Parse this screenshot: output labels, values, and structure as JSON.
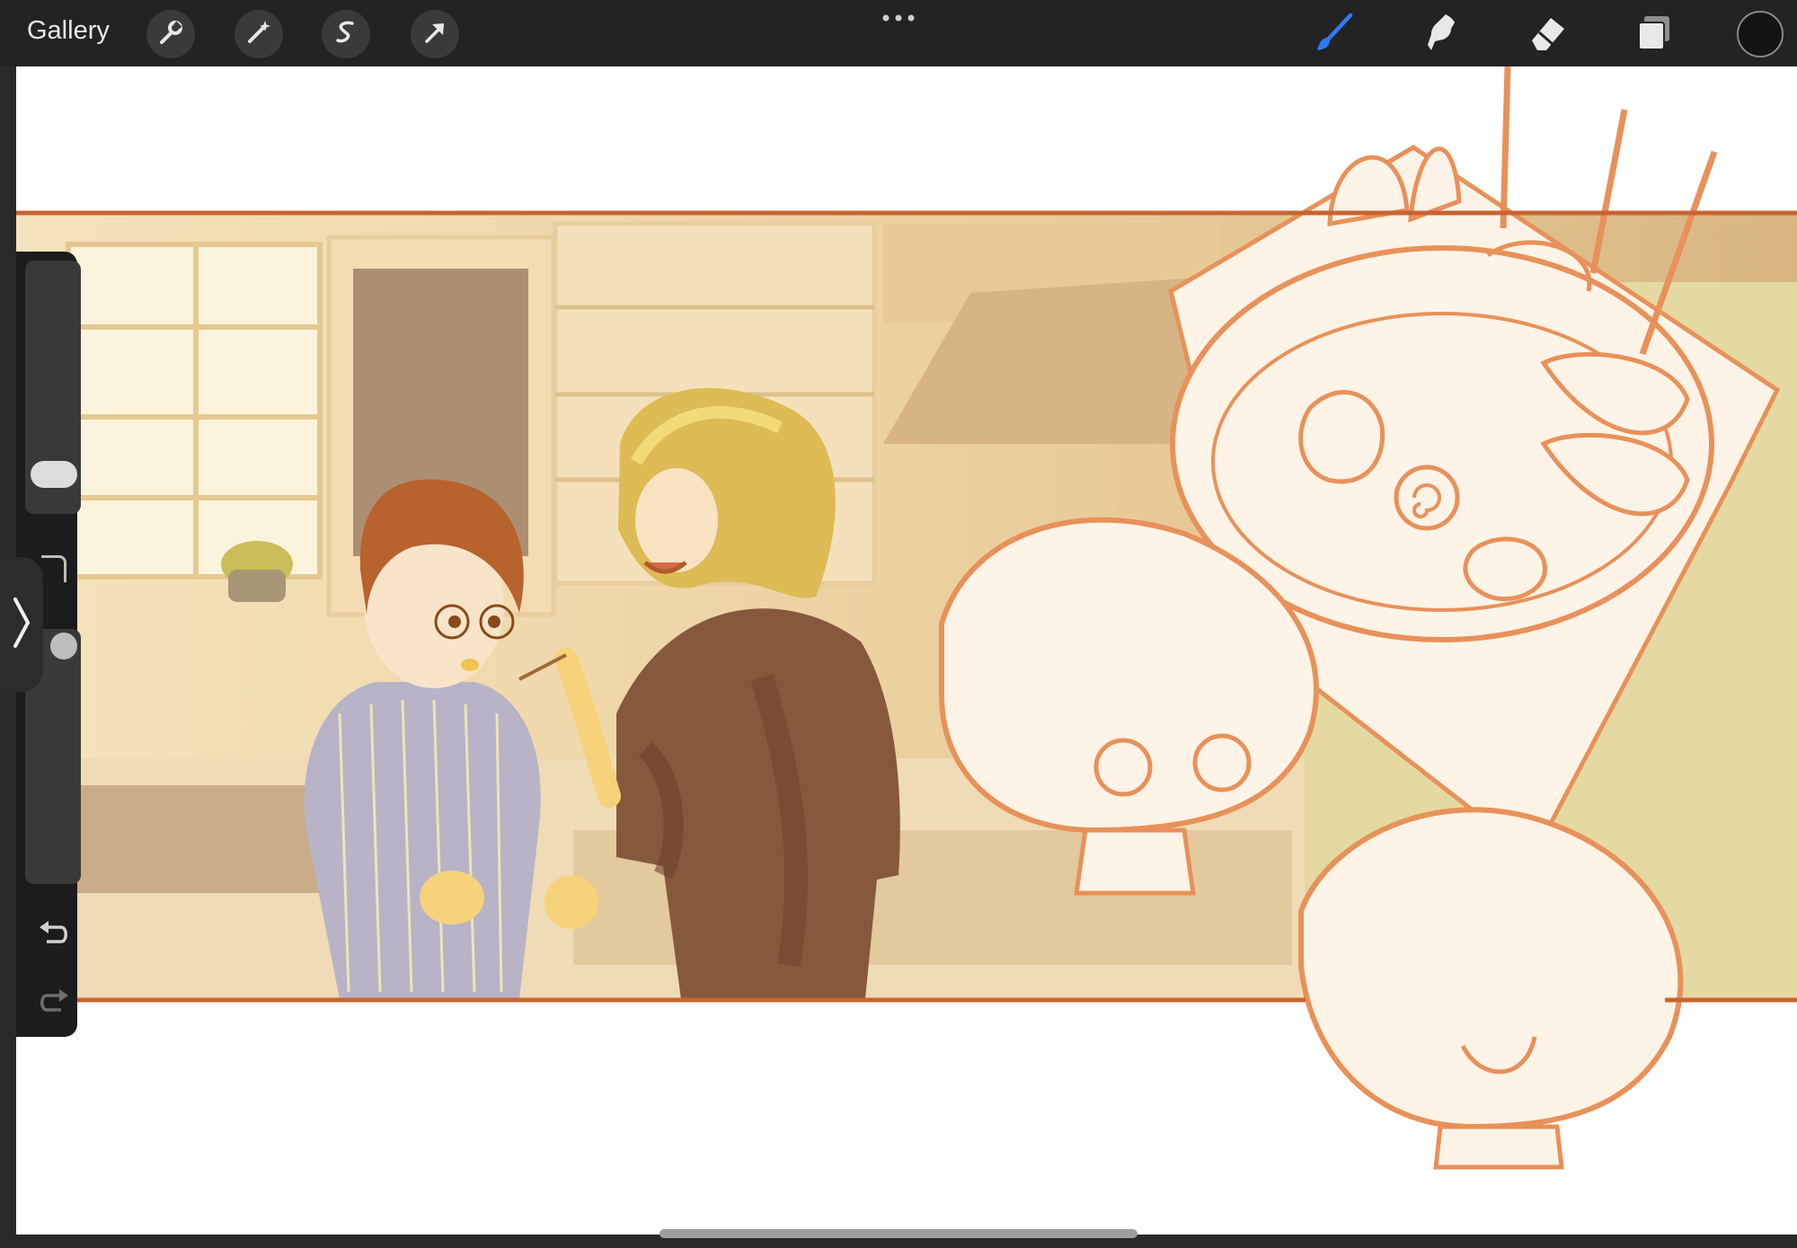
{
  "topbar": {
    "gallery_label": "Gallery",
    "left_tools": [
      "wrench-icon",
      "magic-wand-icon",
      "selection-icon",
      "transform-arrow-icon"
    ],
    "more_menu": "more-dots-icon",
    "right_tools": [
      "brush-icon",
      "smudge-icon",
      "eraser-icon",
      "layers-icon"
    ],
    "active_tool": "brush-icon",
    "current_color": "#141416",
    "accent_color": "#2f7cf6"
  },
  "sidebar": {
    "controls": [
      "brush-size-slider",
      "modify-button",
      "brush-opacity-slider",
      "undo-button",
      "redo-button"
    ],
    "collapse_icon": "chevron-right-icon"
  },
  "canvas": {
    "artwork": "kitchen-illustration",
    "colors": {
      "border": "#c86432",
      "sketch": "#e8915a",
      "warm": "#e6c48c",
      "paper": "#fbeee0"
    }
  }
}
